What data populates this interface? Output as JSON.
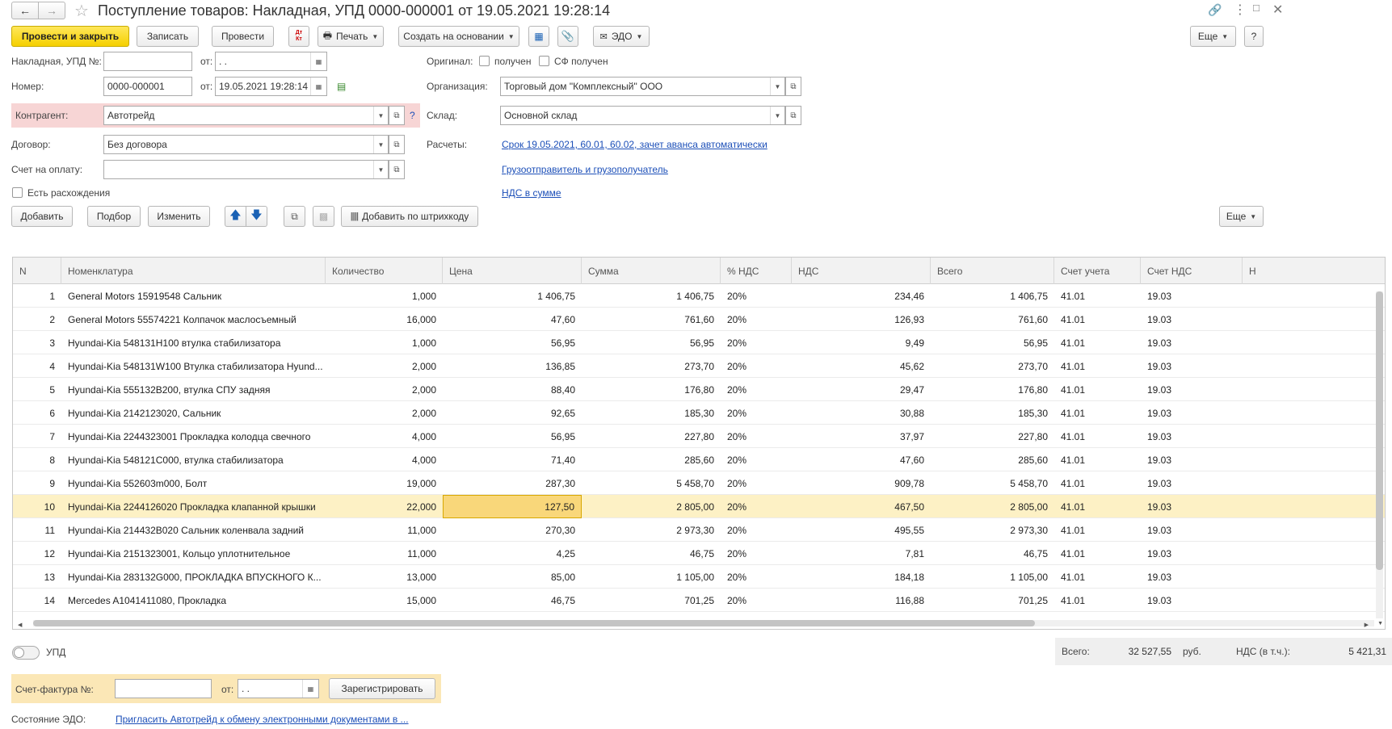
{
  "title": "Поступление товаров: Накладная, УПД 0000-000001 от 19.05.2021 19:28:14",
  "toolbar": {
    "post_close": "Провести и закрыть",
    "save": "Записать",
    "post": "Провести",
    "dtkt": "Дт Кт",
    "print": "Печать",
    "create_based": "Создать на основании",
    "edo": "ЭДО",
    "more": "Еще"
  },
  "form": {
    "invoice_label": "Накладная, УПД №:",
    "invoice_value": "",
    "from_label": "от:",
    "invoice_date": " .  .",
    "number_label": "Номер:",
    "number_value": "0000-000001",
    "number_date": "19.05.2021 19:28:14",
    "counterparty_label": "Контрагент:",
    "counterparty_value": "Автотрейд",
    "help": "?",
    "contract_label": "Договор:",
    "contract_value": "Без договора",
    "payment_label": "Счет на оплату:",
    "payment_value": "",
    "discrepancy_label": "Есть расхождения",
    "original_label": "Оригинал:",
    "received_label": "получен",
    "sf_received_label": "СФ получен",
    "org_label": "Организация:",
    "org_value": "Торговый дом \"Комплексный\" ООО",
    "warehouse_label": "Склад:",
    "warehouse_value": "Основной склад",
    "settlements_label": "Расчеты:",
    "settlements_link": "Срок 19.05.2021, 60.01, 60.02, зачет аванса автоматически",
    "shipper_link": "Грузоотправитель и грузополучатель",
    "vat_link": "НДС в сумме"
  },
  "table_toolbar": {
    "add": "Добавить",
    "pick": "Подбор",
    "change": "Изменить",
    "barcode": "Добавить по штрихкоду",
    "more": "Еще"
  },
  "table": {
    "columns": [
      "N",
      "Номенклатура",
      "Количество",
      "Цена",
      "Сумма",
      "% НДС",
      "НДС",
      "Всего",
      "Счет учета",
      "Счет НДС",
      "Н"
    ],
    "rows": [
      [
        "1",
        "General Motors 15919548 Сальник",
        "1,000",
        "1 406,75",
        "1 406,75",
        "20%",
        "234,46",
        "1 406,75",
        "41.01",
        "19.03"
      ],
      [
        "2",
        "General Motors 55574221 Колпачок маслосъемный",
        "16,000",
        "47,60",
        "761,60",
        "20%",
        "126,93",
        "761,60",
        "41.01",
        "19.03"
      ],
      [
        "3",
        "Hyundai-Kia 548131H100 втулка стабилизатора",
        "1,000",
        "56,95",
        "56,95",
        "20%",
        "9,49",
        "56,95",
        "41.01",
        "19.03"
      ],
      [
        "4",
        "Hyundai-Kia 548131W100 Втулка стабилизатора Hyund...",
        "2,000",
        "136,85",
        "273,70",
        "20%",
        "45,62",
        "273,70",
        "41.01",
        "19.03"
      ],
      [
        "5",
        "Hyundai-Kia 555132B200, втулка СПУ задняя",
        "2,000",
        "88,40",
        "176,80",
        "20%",
        "29,47",
        "176,80",
        "41.01",
        "19.03"
      ],
      [
        "6",
        "Hyundai-Kia 2142123020, Сальник",
        "2,000",
        "92,65",
        "185,30",
        "20%",
        "30,88",
        "185,30",
        "41.01",
        "19.03"
      ],
      [
        "7",
        "Hyundai-Kia 2244323001 Прокладка колодца свечного",
        "4,000",
        "56,95",
        "227,80",
        "20%",
        "37,97",
        "227,80",
        "41.01",
        "19.03"
      ],
      [
        "8",
        "Hyundai-Kia 548121C000, втулка стабилизатора",
        "4,000",
        "71,40",
        "285,60",
        "20%",
        "47,60",
        "285,60",
        "41.01",
        "19.03"
      ],
      [
        "9",
        "Hyundai-Kia 552603m000, Болт",
        "19,000",
        "287,30",
        "5 458,70",
        "20%",
        "909,78",
        "5 458,70",
        "41.01",
        "19.03"
      ],
      [
        "10",
        "Hyundai-Kia 2244126020 Прокладка клапанной крышки",
        "22,000",
        "127,50",
        "2 805,00",
        "20%",
        "467,50",
        "2 805,00",
        "41.01",
        "19.03"
      ],
      [
        "11",
        "Hyundai-Kia 214432B020 Сальник коленвала задний",
        "11,000",
        "270,30",
        "2 973,30",
        "20%",
        "495,55",
        "2 973,30",
        "41.01",
        "19.03"
      ],
      [
        "12",
        "Hyundai-Kia 2151323001, Кольцо уплотнительное",
        "11,000",
        "4,25",
        "46,75",
        "20%",
        "7,81",
        "46,75",
        "41.01",
        "19.03"
      ],
      [
        "13",
        "Hyundai-Kia 283132G000, ПРОКЛАДКА ВПУСКНОГО К...",
        "13,000",
        "85,00",
        "1 105,00",
        "20%",
        "184,18",
        "1 105,00",
        "41.01",
        "19.03"
      ],
      [
        "14",
        "Mercedes A1041411080, Прокладка",
        "15,000",
        "46,75",
        "701,25",
        "20%",
        "116,88",
        "701,25",
        "41.01",
        "19.03"
      ]
    ]
  },
  "footer": {
    "upd_label": "УПД",
    "total_label": "Всего:",
    "total_value": "32 527,55",
    "currency": "руб.",
    "vat_label": "НДС (в т.ч.):",
    "vat_value": "5 421,31",
    "sf_label": "Счет-фактура №:",
    "sf_value": "",
    "sf_from_label": "от:",
    "sf_date": " .  .",
    "register": "Зарегистрировать",
    "edo_state_label": "Состояние ЭДО:",
    "edo_link": "Пригласить Автотрейд к обмену электронными документами в ..."
  }
}
